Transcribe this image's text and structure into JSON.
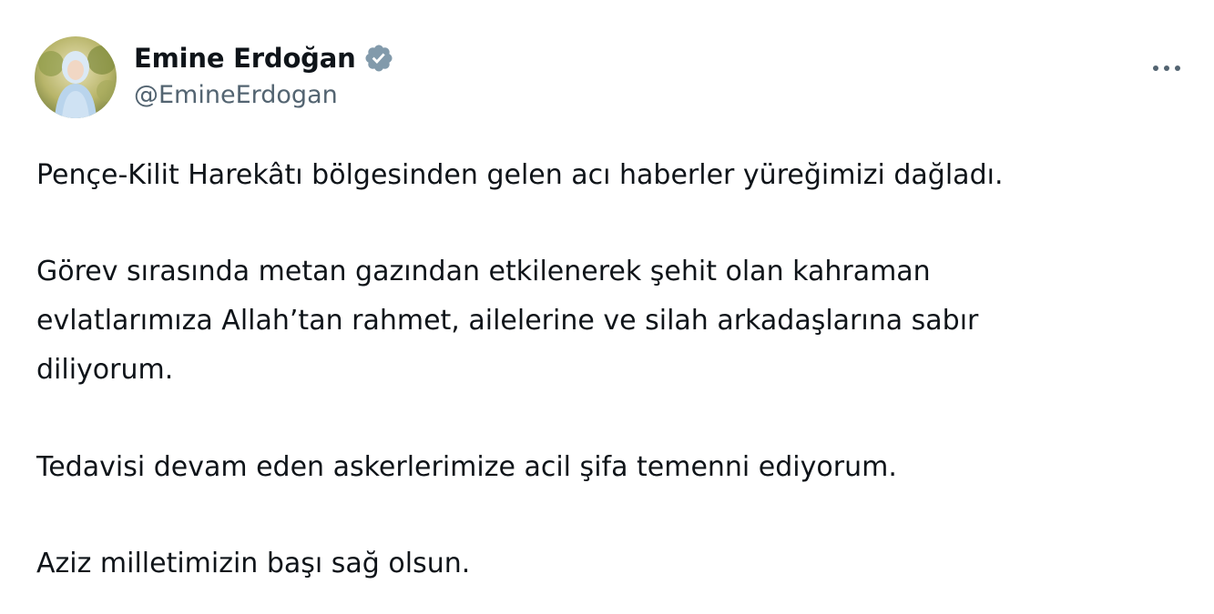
{
  "author": {
    "display_name": "Emine Erdoğan",
    "handle": "@EmineErdogan",
    "verified": true,
    "verified_color": "#829aab"
  },
  "menu": {
    "more_icon": "more-horizontal-icon"
  },
  "tweet": {
    "paragraph_1": "Pençe-Kilit Harekâtı bölgesinden gelen acı haberler yüreğimizi dağladı.",
    "paragraph_2_line_1": "Görev sırasında metan gazından etkilenerek şehit olan kahraman",
    "paragraph_2_line_2": "evlatlarımıza Allah’tan rahmet, ailelerine ve silah arkadaşlarına sabır",
    "paragraph_2_line_3": "diliyorum.",
    "paragraph_3": "Tedavisi devam eden askerlerimize acil şifa temenni ediyorum.",
    "paragraph_4": "Aziz milletimizin başı sağ olsun."
  }
}
